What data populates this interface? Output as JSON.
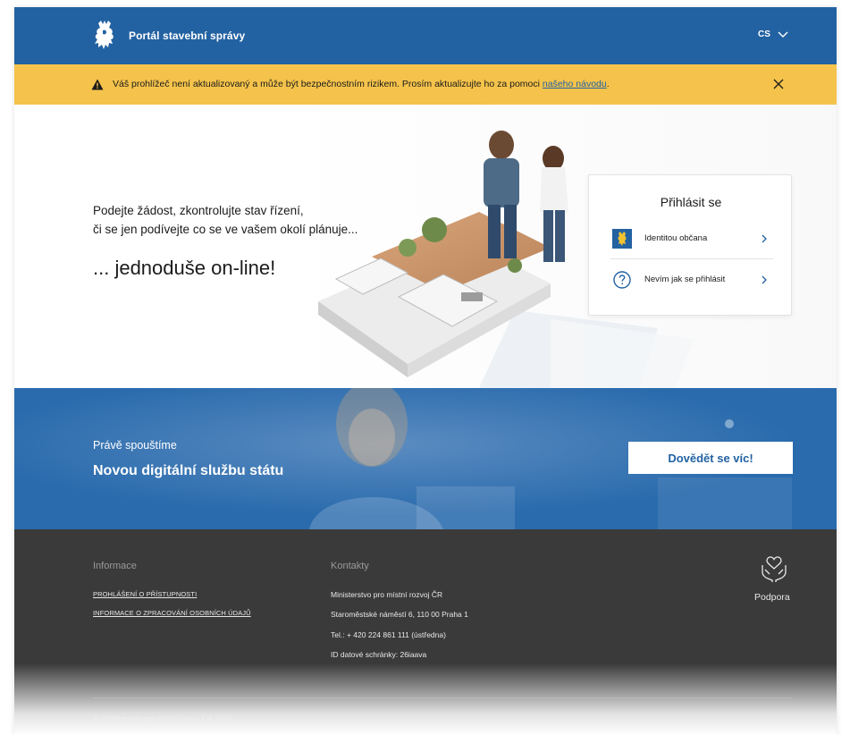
{
  "header": {
    "brand_name": "Portál stavební správy",
    "language": "CS",
    "logo": "czech-lion-emblem"
  },
  "banner": {
    "text": "Váš prohlížeč není aktualizovaný a může být bezpečnostním rizikem. Prosím aktualizujte ho za pomoci ",
    "link_text": "našeho návodu",
    "suffix": ".",
    "color": "#f5c34b"
  },
  "hero": {
    "tagline_line1": "Podejte žádost, zkontrolujte stav řízení,",
    "tagline_line2": "či se jen podívejte co se ve vašem okolí plánuje...",
    "headline": "... jednoduše on-line!"
  },
  "login": {
    "title": "Přihlásit se",
    "options": [
      {
        "label": "Identitou občana",
        "icon": "lion-badge-icon"
      },
      {
        "label": "Nevím jak se přihlásit",
        "icon": "question-circle-icon"
      }
    ]
  },
  "promo": {
    "subtitle": "Právě spouštíme",
    "title": "Novou digitální službu státu",
    "button_label": "Dovědět se víc!"
  },
  "footer": {
    "info_heading": "Informace",
    "info_links": [
      "PROHLÁŠENÍ O PŘÍSTUPNOSTI",
      "INFORMACE O ZPRACOVÁNÍ OSOBNÍCH ÚDAJŮ"
    ],
    "contacts_heading": "Kontakty",
    "contacts": [
      "Ministerstvo pro místní rozvoj ČR",
      "Staroměstské náměstí 6, 110 00 Praha 1",
      "Tel.: + 420 224 861 111 (ústředna)",
      "ID datové schránky: 26iaava"
    ],
    "support_label": "Podpora",
    "copyright": "© Ministerstvo pro místní rozvoj ČR 2024"
  },
  "colors": {
    "primary": "#2362a2",
    "banner": "#f5c34b",
    "footer": "#3a3a3a"
  }
}
